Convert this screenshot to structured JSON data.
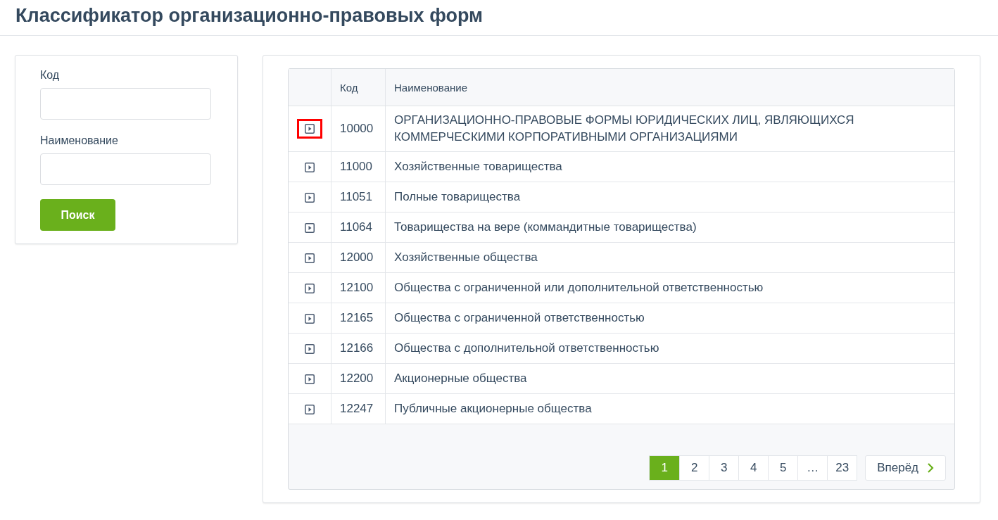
{
  "page_title": "Классификатор организационно-правовых форм",
  "filter": {
    "fields": [
      {
        "label": "Код"
      },
      {
        "label": "Наименование"
      }
    ],
    "search_button": "Поиск"
  },
  "table": {
    "columns": [
      "Код",
      "Наименование"
    ],
    "rows": [
      {
        "code": "10000",
        "name": "ОРГАНИЗАЦИОННО-ПРАВОВЫЕ ФОРМЫ ЮРИДИЧЕСКИХ ЛИЦ, ЯВЛЯЮЩИХСЯ КОММЕРЧЕСКИМИ КОРПОРАТИВНЫМИ ОРГАНИЗАЦИЯМИ",
        "focused": true
      },
      {
        "code": "11000",
        "name": "Хозяйственные товарищества",
        "focused": false
      },
      {
        "code": "11051",
        "name": "Полные товарищества",
        "focused": false
      },
      {
        "code": "11064",
        "name": "Товарищества на вере (коммандитные товарищества)",
        "focused": false
      },
      {
        "code": "12000",
        "name": "Хозяйственные общества",
        "focused": false
      },
      {
        "code": "12100",
        "name": "Общества с ограниченной или дополнительной ответственностью",
        "focused": false
      },
      {
        "code": "12165",
        "name": "Общества с ограниченной ответственностью",
        "focused": false
      },
      {
        "code": "12166",
        "name": "Общества с дополнительной ответственностью",
        "focused": false
      },
      {
        "code": "12200",
        "name": "Акционерные общества",
        "focused": false
      },
      {
        "code": "12247",
        "name": "Публичные акционерные общества",
        "focused": false
      }
    ]
  },
  "pagination": {
    "pages": [
      {
        "label": "1",
        "selected": true
      },
      {
        "label": "2",
        "selected": false
      },
      {
        "label": "3",
        "selected": false
      },
      {
        "label": "4",
        "selected": false
      },
      {
        "label": "5",
        "selected": false
      },
      {
        "label": "…",
        "selected": false
      },
      {
        "label": "23",
        "selected": false
      }
    ],
    "next": "Вперёд"
  }
}
